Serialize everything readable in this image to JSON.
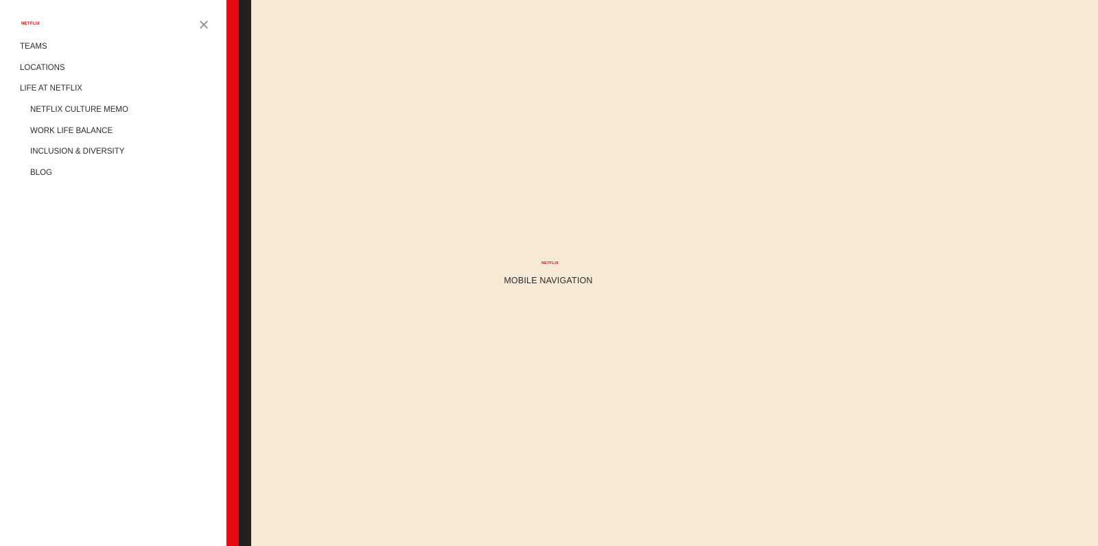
{
  "brand": {
    "logo_text": "NETFLIX",
    "color": "#e50914"
  },
  "drawer": {
    "close_icon": "close-icon",
    "items": [
      {
        "label": "TEAMS",
        "level": "top"
      },
      {
        "label": "LOCATIONS",
        "level": "top"
      },
      {
        "label": "LIFE AT NETFLIX",
        "level": "top"
      },
      {
        "label": "NETFLIX CULTURE MEMO",
        "level": "sub"
      },
      {
        "label": "WORK LIFE BALANCE",
        "level": "sub"
      },
      {
        "label": "INCLUSION & DIVERSITY",
        "level": "sub"
      },
      {
        "label": "BLOG",
        "level": "sub"
      }
    ]
  },
  "main": {
    "logo_text": "NETFLIX",
    "caption": "MOBILE NAVIGATION",
    "background": "#f8e9d6"
  },
  "stripes": {
    "red": "#e50914",
    "dark": "#221f1f"
  }
}
